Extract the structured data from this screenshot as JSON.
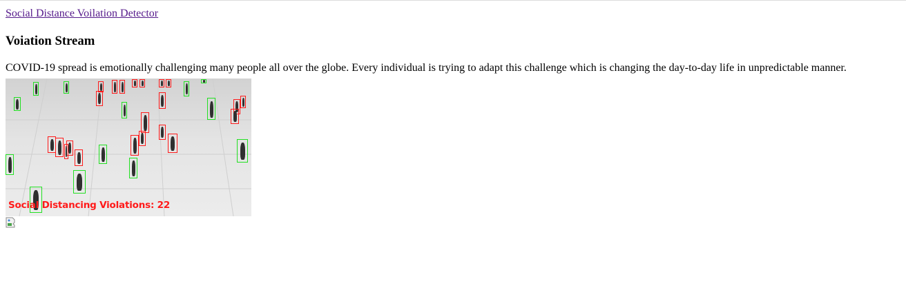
{
  "nav": {
    "title_link": "Social Distance Voilation Detector"
  },
  "main": {
    "heading": "Voiation Stream",
    "description": "COVID-19 spread is emotionally challenging many people all over the globe. Every individual is trying to adapt this challenge which is changing the day-to-day life in unpredictable manner."
  },
  "stream": {
    "overlay_text": "Social Distancing Violations: 22",
    "colors": {
      "violation": "#ff1a1a",
      "safe": "#22e022",
      "link": "#551a8b"
    },
    "boxes": [
      {
        "k": "s"
      },
      {
        "k": "s"
      },
      {
        "k": "s"
      },
      {
        "k": "v"
      },
      {
        "k": "v"
      },
      {
        "k": "v"
      },
      {
        "k": "v"
      },
      {
        "k": "v"
      },
      {
        "k": "v"
      },
      {
        "k": "v"
      },
      {
        "k": "v"
      },
      {
        "k": "s"
      },
      {
        "k": "s"
      },
      {
        "k": "s"
      },
      {
        "k": "v"
      },
      {
        "k": "v"
      },
      {
        "k": "v"
      },
      {
        "k": "s"
      },
      {
        "k": "v"
      },
      {
        "k": "v"
      },
      {
        "k": "v"
      },
      {
        "k": "v"
      },
      {
        "k": "v"
      },
      {
        "k": "v"
      },
      {
        "k": "v"
      },
      {
        "k": "v"
      },
      {
        "k": "s"
      },
      {
        "k": "s"
      },
      {
        "k": "v"
      },
      {
        "k": "s"
      },
      {
        "k": "s"
      },
      {
        "k": "s"
      },
      {
        "k": "v"
      },
      {
        "k": "v"
      },
      {
        "k": "s"
      }
    ]
  },
  "broken_image_icon": "broken-image-icon"
}
